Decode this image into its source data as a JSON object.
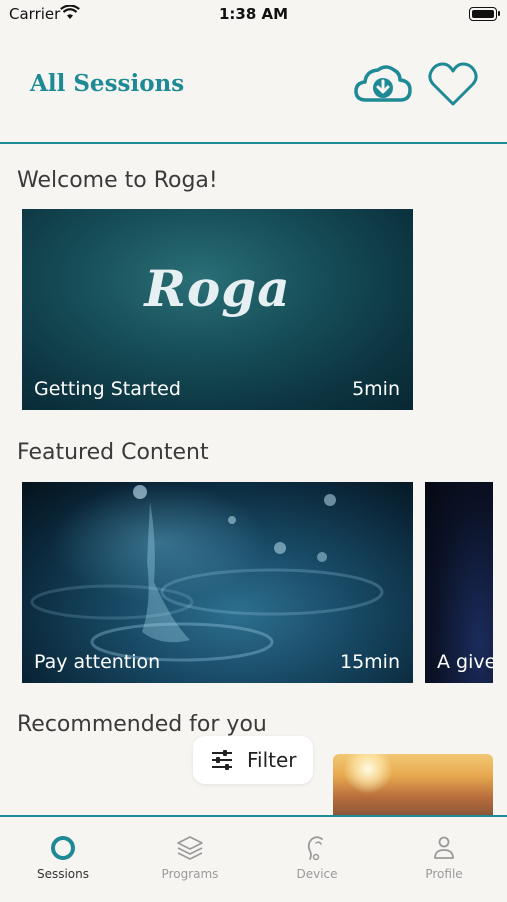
{
  "status_bar": {
    "carrier": "Carrier",
    "time": "1:38 AM"
  },
  "header": {
    "title": "All Sessions",
    "download_icon": "cloud-download-icon",
    "favorite_icon": "heart-icon"
  },
  "welcome": {
    "title": "Welcome to Roga!",
    "card": {
      "logo": "Roga",
      "label": "Getting Started",
      "duration": "5min"
    }
  },
  "featured": {
    "title": "Featured Content",
    "cards": [
      {
        "label": "Pay attention",
        "duration": "15min"
      },
      {
        "label": "A give"
      }
    ]
  },
  "recommended": {
    "title": "Recommended for you"
  },
  "filter": {
    "label": "Filter",
    "icon": "sliders-icon"
  },
  "tabbar": {
    "tabs": [
      {
        "label": "Sessions",
        "icon": "circle-icon",
        "active": true
      },
      {
        "label": "Programs",
        "icon": "layers-icon"
      },
      {
        "label": "Device",
        "icon": "ear-icon"
      },
      {
        "label": "Profile",
        "icon": "person-icon"
      }
    ]
  },
  "colors": {
    "accent": "#1e8a95",
    "background": "#f7f5f1"
  }
}
